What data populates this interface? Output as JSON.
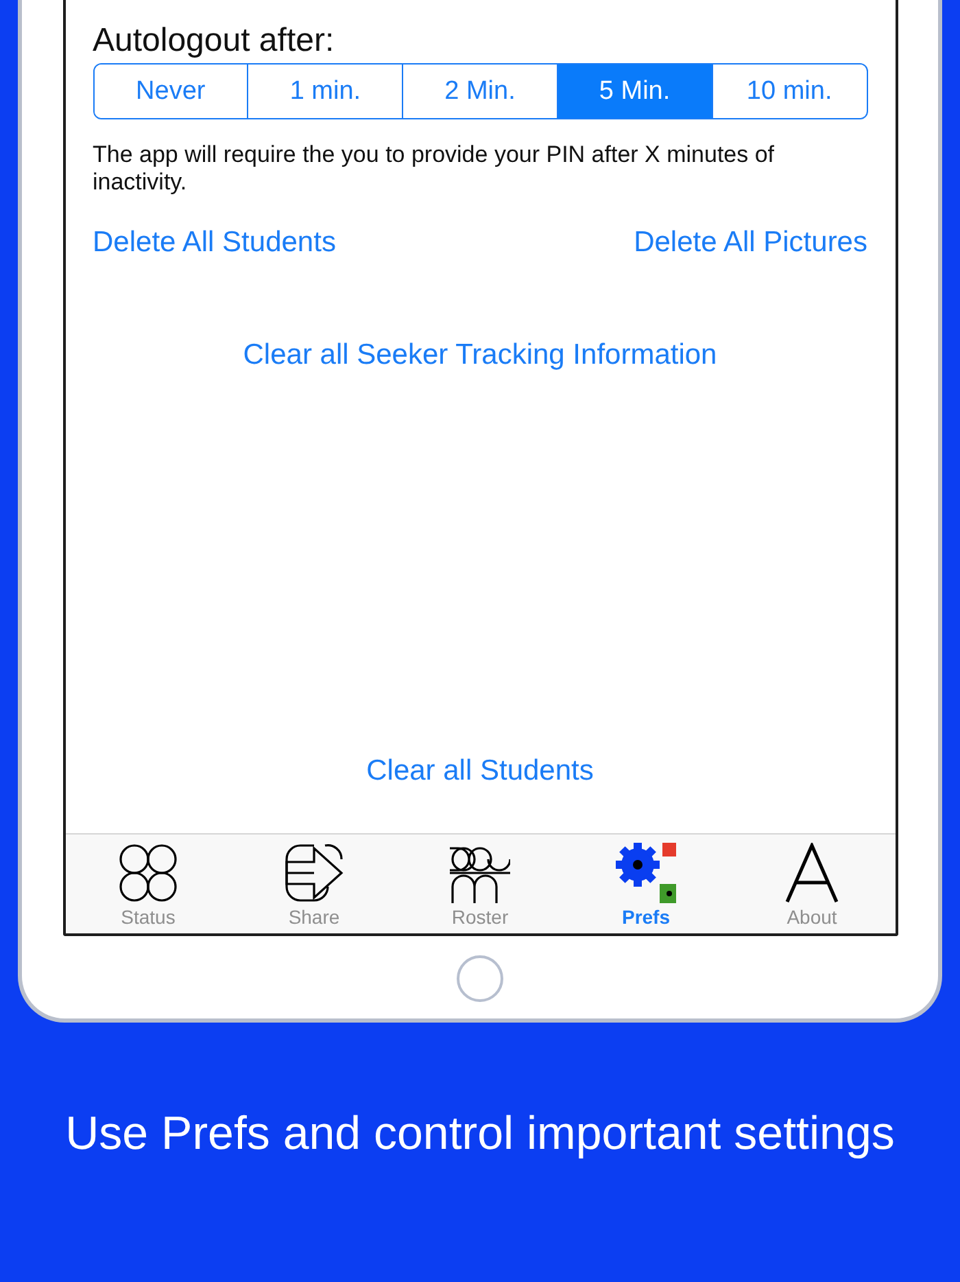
{
  "autologout": {
    "label": "Autologout after:",
    "options": [
      {
        "label": "Never",
        "selected": false
      },
      {
        "label": "1 min.",
        "selected": false
      },
      {
        "label": "2 Min.",
        "selected": false
      },
      {
        "label": "5 Min.",
        "selected": true
      },
      {
        "label": "10 min.",
        "selected": false
      }
    ],
    "description": "The app will require the you to provide your PIN after X minutes of inactivity."
  },
  "actions": {
    "delete_students": "Delete All Students",
    "delete_pictures": "Delete All Pictures",
    "clear_tracking": "Clear all Seeker Tracking Information",
    "clear_students": "Clear all Students"
  },
  "tabs": [
    {
      "label": "Status",
      "kind": "circles",
      "selected": false
    },
    {
      "label": "Share",
      "kind": "share",
      "selected": false
    },
    {
      "label": "Roster",
      "kind": "roster",
      "selected": false
    },
    {
      "label": "Prefs",
      "kind": "gears",
      "selected": true
    },
    {
      "label": "About",
      "kind": "letter",
      "selected": false
    }
  ],
  "caption": "Use Prefs and control important settings"
}
